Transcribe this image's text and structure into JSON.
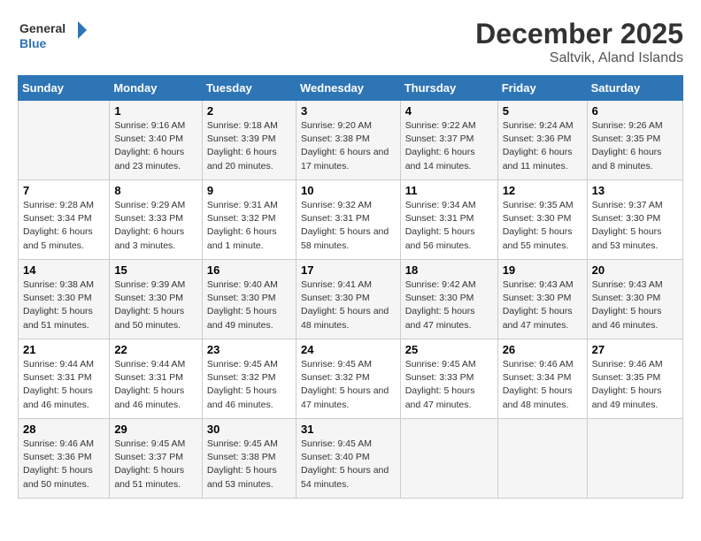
{
  "header": {
    "logo_line1": "General",
    "logo_line2": "Blue",
    "month_title": "December 2025",
    "location": "Saltvik, Aland Islands"
  },
  "weekdays": [
    "Sunday",
    "Monday",
    "Tuesday",
    "Wednesday",
    "Thursday",
    "Friday",
    "Saturday"
  ],
  "weeks": [
    [
      {
        "day": "",
        "sunrise": "",
        "sunset": "",
        "daylight": ""
      },
      {
        "day": "1",
        "sunrise": "Sunrise: 9:16 AM",
        "sunset": "Sunset: 3:40 PM",
        "daylight": "Daylight: 6 hours and 23 minutes."
      },
      {
        "day": "2",
        "sunrise": "Sunrise: 9:18 AM",
        "sunset": "Sunset: 3:39 PM",
        "daylight": "Daylight: 6 hours and 20 minutes."
      },
      {
        "day": "3",
        "sunrise": "Sunrise: 9:20 AM",
        "sunset": "Sunset: 3:38 PM",
        "daylight": "Daylight: 6 hours and 17 minutes."
      },
      {
        "day": "4",
        "sunrise": "Sunrise: 9:22 AM",
        "sunset": "Sunset: 3:37 PM",
        "daylight": "Daylight: 6 hours and 14 minutes."
      },
      {
        "day": "5",
        "sunrise": "Sunrise: 9:24 AM",
        "sunset": "Sunset: 3:36 PM",
        "daylight": "Daylight: 6 hours and 11 minutes."
      },
      {
        "day": "6",
        "sunrise": "Sunrise: 9:26 AM",
        "sunset": "Sunset: 3:35 PM",
        "daylight": "Daylight: 6 hours and 8 minutes."
      }
    ],
    [
      {
        "day": "7",
        "sunrise": "Sunrise: 9:28 AM",
        "sunset": "Sunset: 3:34 PM",
        "daylight": "Daylight: 6 hours and 5 minutes."
      },
      {
        "day": "8",
        "sunrise": "Sunrise: 9:29 AM",
        "sunset": "Sunset: 3:33 PM",
        "daylight": "Daylight: 6 hours and 3 minutes."
      },
      {
        "day": "9",
        "sunrise": "Sunrise: 9:31 AM",
        "sunset": "Sunset: 3:32 PM",
        "daylight": "Daylight: 6 hours and 1 minute."
      },
      {
        "day": "10",
        "sunrise": "Sunrise: 9:32 AM",
        "sunset": "Sunset: 3:31 PM",
        "daylight": "Daylight: 5 hours and 58 minutes."
      },
      {
        "day": "11",
        "sunrise": "Sunrise: 9:34 AM",
        "sunset": "Sunset: 3:31 PM",
        "daylight": "Daylight: 5 hours and 56 minutes."
      },
      {
        "day": "12",
        "sunrise": "Sunrise: 9:35 AM",
        "sunset": "Sunset: 3:30 PM",
        "daylight": "Daylight: 5 hours and 55 minutes."
      },
      {
        "day": "13",
        "sunrise": "Sunrise: 9:37 AM",
        "sunset": "Sunset: 3:30 PM",
        "daylight": "Daylight: 5 hours and 53 minutes."
      }
    ],
    [
      {
        "day": "14",
        "sunrise": "Sunrise: 9:38 AM",
        "sunset": "Sunset: 3:30 PM",
        "daylight": "Daylight: 5 hours and 51 minutes."
      },
      {
        "day": "15",
        "sunrise": "Sunrise: 9:39 AM",
        "sunset": "Sunset: 3:30 PM",
        "daylight": "Daylight: 5 hours and 50 minutes."
      },
      {
        "day": "16",
        "sunrise": "Sunrise: 9:40 AM",
        "sunset": "Sunset: 3:30 PM",
        "daylight": "Daylight: 5 hours and 49 minutes."
      },
      {
        "day": "17",
        "sunrise": "Sunrise: 9:41 AM",
        "sunset": "Sunset: 3:30 PM",
        "daylight": "Daylight: 5 hours and 48 minutes."
      },
      {
        "day": "18",
        "sunrise": "Sunrise: 9:42 AM",
        "sunset": "Sunset: 3:30 PM",
        "daylight": "Daylight: 5 hours and 47 minutes."
      },
      {
        "day": "19",
        "sunrise": "Sunrise: 9:43 AM",
        "sunset": "Sunset: 3:30 PM",
        "daylight": "Daylight: 5 hours and 47 minutes."
      },
      {
        "day": "20",
        "sunrise": "Sunrise: 9:43 AM",
        "sunset": "Sunset: 3:30 PM",
        "daylight": "Daylight: 5 hours and 46 minutes."
      }
    ],
    [
      {
        "day": "21",
        "sunrise": "Sunrise: 9:44 AM",
        "sunset": "Sunset: 3:31 PM",
        "daylight": "Daylight: 5 hours and 46 minutes."
      },
      {
        "day": "22",
        "sunrise": "Sunrise: 9:44 AM",
        "sunset": "Sunset: 3:31 PM",
        "daylight": "Daylight: 5 hours and 46 minutes."
      },
      {
        "day": "23",
        "sunrise": "Sunrise: 9:45 AM",
        "sunset": "Sunset: 3:32 PM",
        "daylight": "Daylight: 5 hours and 46 minutes."
      },
      {
        "day": "24",
        "sunrise": "Sunrise: 9:45 AM",
        "sunset": "Sunset: 3:32 PM",
        "daylight": "Daylight: 5 hours and 47 minutes."
      },
      {
        "day": "25",
        "sunrise": "Sunrise: 9:45 AM",
        "sunset": "Sunset: 3:33 PM",
        "daylight": "Daylight: 5 hours and 47 minutes."
      },
      {
        "day": "26",
        "sunrise": "Sunrise: 9:46 AM",
        "sunset": "Sunset: 3:34 PM",
        "daylight": "Daylight: 5 hours and 48 minutes."
      },
      {
        "day": "27",
        "sunrise": "Sunrise: 9:46 AM",
        "sunset": "Sunset: 3:35 PM",
        "daylight": "Daylight: 5 hours and 49 minutes."
      }
    ],
    [
      {
        "day": "28",
        "sunrise": "Sunrise: 9:46 AM",
        "sunset": "Sunset: 3:36 PM",
        "daylight": "Daylight: 5 hours and 50 minutes."
      },
      {
        "day": "29",
        "sunrise": "Sunrise: 9:45 AM",
        "sunset": "Sunset: 3:37 PM",
        "daylight": "Daylight: 5 hours and 51 minutes."
      },
      {
        "day": "30",
        "sunrise": "Sunrise: 9:45 AM",
        "sunset": "Sunset: 3:38 PM",
        "daylight": "Daylight: 5 hours and 53 minutes."
      },
      {
        "day": "31",
        "sunrise": "Sunrise: 9:45 AM",
        "sunset": "Sunset: 3:40 PM",
        "daylight": "Daylight: 5 hours and 54 minutes."
      },
      {
        "day": "",
        "sunrise": "",
        "sunset": "",
        "daylight": ""
      },
      {
        "day": "",
        "sunrise": "",
        "sunset": "",
        "daylight": ""
      },
      {
        "day": "",
        "sunrise": "",
        "sunset": "",
        "daylight": ""
      }
    ]
  ]
}
